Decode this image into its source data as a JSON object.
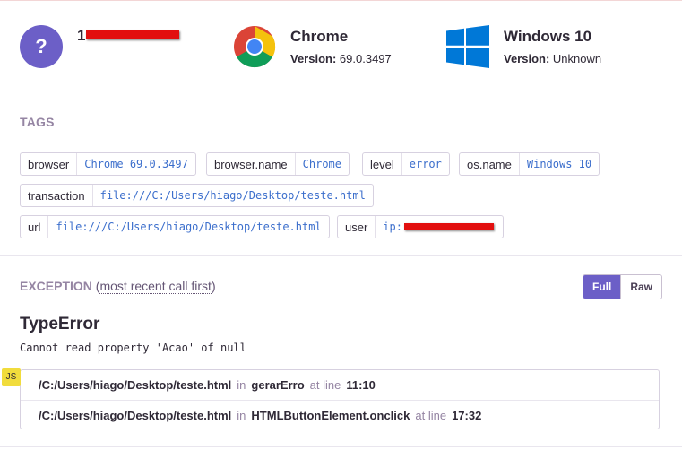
{
  "user": {
    "avatar_glyph": "?",
    "ip_visible_prefix": "1"
  },
  "browser": {
    "name": "Chrome",
    "version_label": "Version:",
    "version": "69.0.3497"
  },
  "os": {
    "name": "Windows 10",
    "version_label": "Version:",
    "version": "Unknown"
  },
  "tags": {
    "title": "TAGS",
    "items": [
      {
        "key": "browser",
        "value": "Chrome 69.0.3497"
      },
      {
        "key": "browser.name",
        "value": "Chrome"
      },
      {
        "key": "level",
        "value": "error"
      },
      {
        "key": "os.name",
        "value": "Windows 10"
      },
      {
        "key": "transaction",
        "value": "file:///C:/Users/hiago/Desktop/teste.html"
      },
      {
        "key": "url",
        "value": "file:///C:/Users/hiago/Desktop/teste.html"
      },
      {
        "key": "user",
        "value": "ip:"
      }
    ]
  },
  "exception": {
    "title": "EXCEPTION",
    "subtitle_open": "(",
    "subtitle_link": "most recent call first",
    "subtitle_close": ")",
    "toggle": {
      "full": "Full",
      "raw": "Raw",
      "active": "Full"
    },
    "type": "TypeError",
    "message": "Cannot read property 'Acao' of null",
    "platform_badge": "JS",
    "frames": [
      {
        "file": "/C:/Users/hiago/Desktop/teste.html",
        "in_label": "in",
        "function": "gerarErro",
        "at_label": "at line",
        "line": "11:10"
      },
      {
        "file": "/C:/Users/hiago/Desktop/teste.html",
        "in_label": "in",
        "function": "HTMLButtonElement.onclick",
        "at_label": "at line",
        "line": "17:32"
      }
    ]
  },
  "colors": {
    "accent": "#6c5fc7",
    "link": "#3b6ecc",
    "muted": "#9585a3",
    "redaction": "#e20f0f",
    "js_badge": "#f1dc3c"
  },
  "icons": {
    "user": "question-avatar-icon",
    "browser": "chrome-logo-icon",
    "os": "windows-logo-icon"
  }
}
